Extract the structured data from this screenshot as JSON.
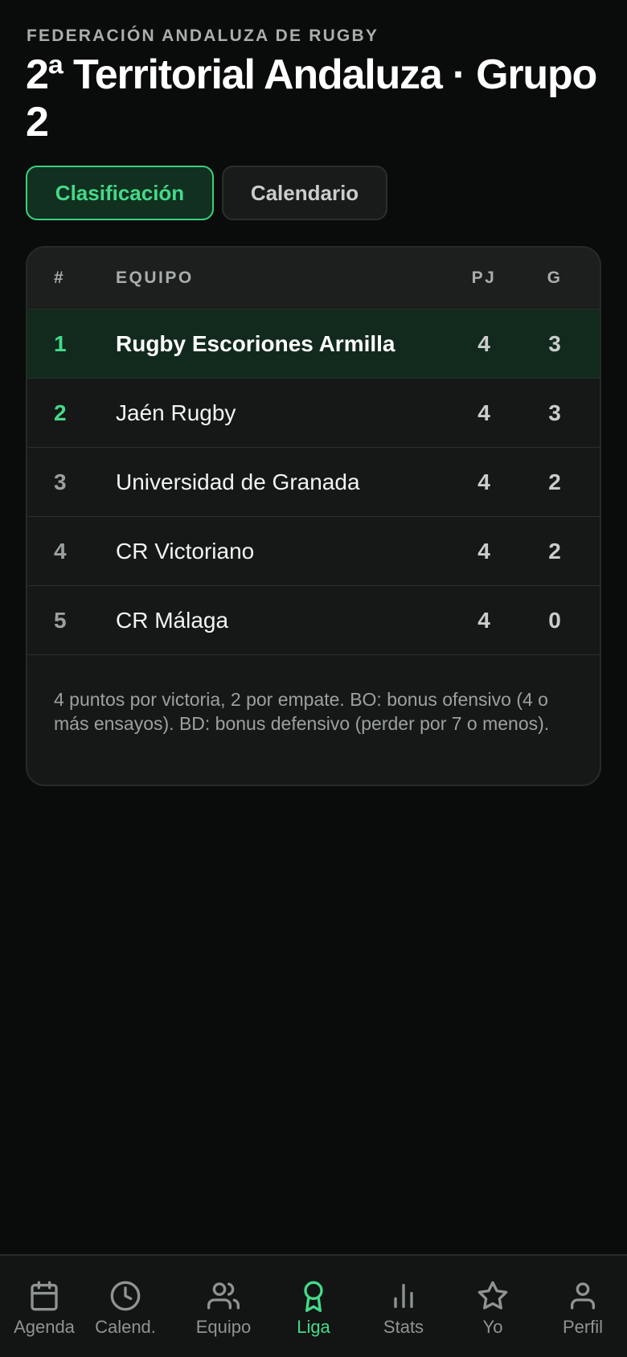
{
  "header": {
    "eyebrow": "FEDERACIÓN ANDALUZA DE RUGBY",
    "title": "2ª Territorial Andaluza · Grupo 2"
  },
  "tabs": [
    {
      "label": "Clasificación",
      "active": true
    },
    {
      "label": "Calendario",
      "active": false
    }
  ],
  "table": {
    "columns": {
      "pos": "#",
      "team": "EQUIPO",
      "pj": "PJ",
      "g": "G"
    },
    "rows": [
      {
        "pos": "1",
        "team": "Rugby Escoriones Armilla",
        "pj": "4",
        "g": "3"
      },
      {
        "pos": "2",
        "team": "Jaén Rugby",
        "pj": "4",
        "g": "3"
      },
      {
        "pos": "3",
        "team": "Universidad de Granada",
        "pj": "4",
        "g": "2"
      },
      {
        "pos": "4",
        "team": "CR Victoriano",
        "pj": "4",
        "g": "2"
      },
      {
        "pos": "5",
        "team": "CR Málaga",
        "pj": "4",
        "g": "0"
      }
    ],
    "note": "4 puntos por victoria, 2 por empate. BO: bonus ofensivo (4 o más ensayos). BD: bonus defensivo (perder por 7 o menos)."
  },
  "nav": {
    "items": [
      {
        "label": "Agenda",
        "icon": "calendar-icon"
      },
      {
        "label": "Calend.",
        "icon": "clock-icon"
      },
      {
        "label": "Equipo",
        "icon": "users-icon"
      },
      {
        "label": "Liga",
        "icon": "award-icon",
        "active": true
      },
      {
        "label": "Stats",
        "icon": "bar-chart-icon"
      },
      {
        "label": "Yo",
        "icon": "star-icon"
      },
      {
        "label": "Perfil",
        "icon": "user-icon"
      }
    ]
  },
  "colors": {
    "background": "#0a0c0b",
    "accent": "#45d98a",
    "card": "#151817",
    "leader_row": "#122a1d"
  }
}
